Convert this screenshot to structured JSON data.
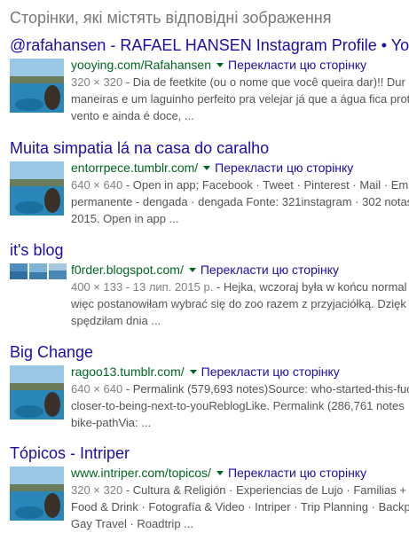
{
  "section_heading": "Сторінки, які містять відповідні зображення",
  "translate_label": "Перекласти цю сторінку",
  "results": [
    {
      "title": "@rafahansen - RAFAEL HANSEN Instagram Profile • Yo",
      "url": "yooying.com/Rafahansen",
      "meta": "320 × 320",
      "snippet_lines": [
        " - Dia de feetkite (ou o nome que você queira dar)!! Dur",
        "maneiras e um laguinho perfeito pra velejar já que a água fica prot",
        "vento e ainda é doce, ..."
      ]
    },
    {
      "title": "Muita simpatia lá na casa do caralho",
      "url": "entorrpece.tumblr.com/",
      "meta": "640 × 640",
      "snippet_lines": [
        " - Open in app; Facebook · Tweet · Pinterest · Mail · Em",
        "permanente - dengada · dengada Fonte: 321instagram · 302 notas",
        "2015. Open in app ..."
      ]
    },
    {
      "title": "it's blog",
      "url": "f0rder.blogspot.com/",
      "meta": "400 × 133 - 13 лип. 2015 р.",
      "snippet_lines": [
        " - Hejka, wczoraj była w końcu normal",
        "więc postanowiłam wybrać się do zoo razem z przyjaciółką. Dzięk",
        "spędziłam dnia ..."
      ]
    },
    {
      "title": "Big Change",
      "url": "ragoo13.tumblr.com/",
      "meta": "640 × 640",
      "snippet_lines": [
        " - Permalink (579,693 notes)Source: who-started-this-fuc",
        "closer-to-being-next-to-youReblogLike. Permalink (286,761 notes",
        "bike-pathVia: ..."
      ]
    },
    {
      "title": "Tópicos - Intriper",
      "url": "www.intriper.com/topicos/",
      "meta": "320 × 320",
      "snippet_lines": [
        " - Cultura & Religión · Experiencias de Lujo · Familias +",
        "Food & Drink · Fotografía & Video · Intriper · Trip Planning · Backp",
        "Gay Travel · Roadtrip ..."
      ]
    }
  ]
}
